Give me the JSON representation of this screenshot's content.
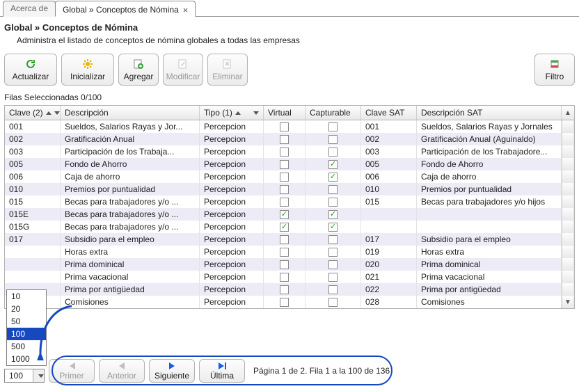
{
  "tabs": {
    "inactive": "Acerca de",
    "active": "Global » Conceptos de Nómina"
  },
  "title": "Global » Conceptos de Nómina",
  "subtitle": "Administra el listado de conceptos de nómina globales a todas las empresas",
  "toolbar": {
    "actualizar": "Actualizar",
    "inicializar": "Inicializar",
    "agregar": "Agregar",
    "modificar": "Modificar",
    "eliminar": "Eliminar",
    "filtro": "Filtro"
  },
  "selection_text": "Filas Seleccionadas  0/100",
  "columns": {
    "clave": "Clave (2)",
    "descripcion": "Descripción",
    "tipo": "Tipo (1)",
    "virtual": "Virtual",
    "capturable": "Capturable",
    "clave_sat": "Clave SAT",
    "descripcion_sat": "Descripción SAT"
  },
  "rows": [
    {
      "clave": "001",
      "desc": "Sueldos, Salarios  Rayas y Jor...",
      "tipo": "Percepcion",
      "virtual": false,
      "cap": false,
      "csat": "001",
      "dsat": "Sueldos, Salarios  Rayas y Jornales"
    },
    {
      "clave": "002",
      "desc": "Gratificación Anual",
      "tipo": "Percepcion",
      "virtual": false,
      "cap": false,
      "csat": "002",
      "dsat": "Gratificación Anual (Aguinaldo)"
    },
    {
      "clave": "003",
      "desc": "Participación de los Trabaja...",
      "tipo": "Percepcion",
      "virtual": false,
      "cap": false,
      "csat": "003",
      "dsat": "Participación de los Trabajadore..."
    },
    {
      "clave": "005",
      "desc": "Fondo de Ahorro",
      "tipo": "Percepcion",
      "virtual": false,
      "cap": true,
      "csat": "005",
      "dsat": "Fondo de Ahorro"
    },
    {
      "clave": "006",
      "desc": "Caja de ahorro",
      "tipo": "Percepcion",
      "virtual": false,
      "cap": true,
      "csat": "006",
      "dsat": "Caja de ahorro"
    },
    {
      "clave": "010",
      "desc": "Premios por puntualidad",
      "tipo": "Percepcion",
      "virtual": false,
      "cap": false,
      "csat": "010",
      "dsat": "Premios por puntualidad"
    },
    {
      "clave": "015",
      "desc": "Becas para trabajadores y/o ...",
      "tipo": "Percepcion",
      "virtual": false,
      "cap": false,
      "csat": "015",
      "dsat": "Becas para trabajadores y/o hijos"
    },
    {
      "clave": "015E",
      "desc": "Becas para trabajadores y/o ...",
      "tipo": "Percepcion",
      "virtual": true,
      "cap": true,
      "csat": "",
      "dsat": ""
    },
    {
      "clave": "015G",
      "desc": "Becas para trabajadores y/o ...",
      "tipo": "Percepcion",
      "virtual": true,
      "cap": true,
      "csat": "",
      "dsat": ""
    },
    {
      "clave": "017",
      "desc": "Subsidio para el empleo",
      "tipo": "Percepcion",
      "virtual": false,
      "cap": false,
      "csat": "017",
      "dsat": "Subsidio para el empleo"
    },
    {
      "clave": "",
      "desc": "Horas extra",
      "tipo": "Percepcion",
      "virtual": false,
      "cap": false,
      "csat": "019",
      "dsat": "Horas extra"
    },
    {
      "clave": "",
      "desc": "Prima dominical",
      "tipo": "Percepcion",
      "virtual": false,
      "cap": false,
      "csat": "020",
      "dsat": "Prima dominical"
    },
    {
      "clave": "",
      "desc": "Prima vacacional",
      "tipo": "Percepcion",
      "virtual": false,
      "cap": false,
      "csat": "021",
      "dsat": "Prima vacacional"
    },
    {
      "clave": "",
      "desc": "Prima por antigüedad",
      "tipo": "Percepcion",
      "virtual": false,
      "cap": false,
      "csat": "022",
      "dsat": "Prima por antigüedad"
    },
    {
      "clave": "",
      "desc": "Comisiones",
      "tipo": "Percepcion",
      "virtual": false,
      "cap": false,
      "csat": "028",
      "dsat": "Comisiones"
    }
  ],
  "page_size_options": [
    "10",
    "20",
    "50",
    "100",
    "500",
    "1000"
  ],
  "page_size_selected": "100",
  "pager": {
    "first": "Primer",
    "prev": "Anterior",
    "next": "Siguiente",
    "last": "Última",
    "status": "Página 1 de 2. Fila 1 a la 100 de 136"
  }
}
